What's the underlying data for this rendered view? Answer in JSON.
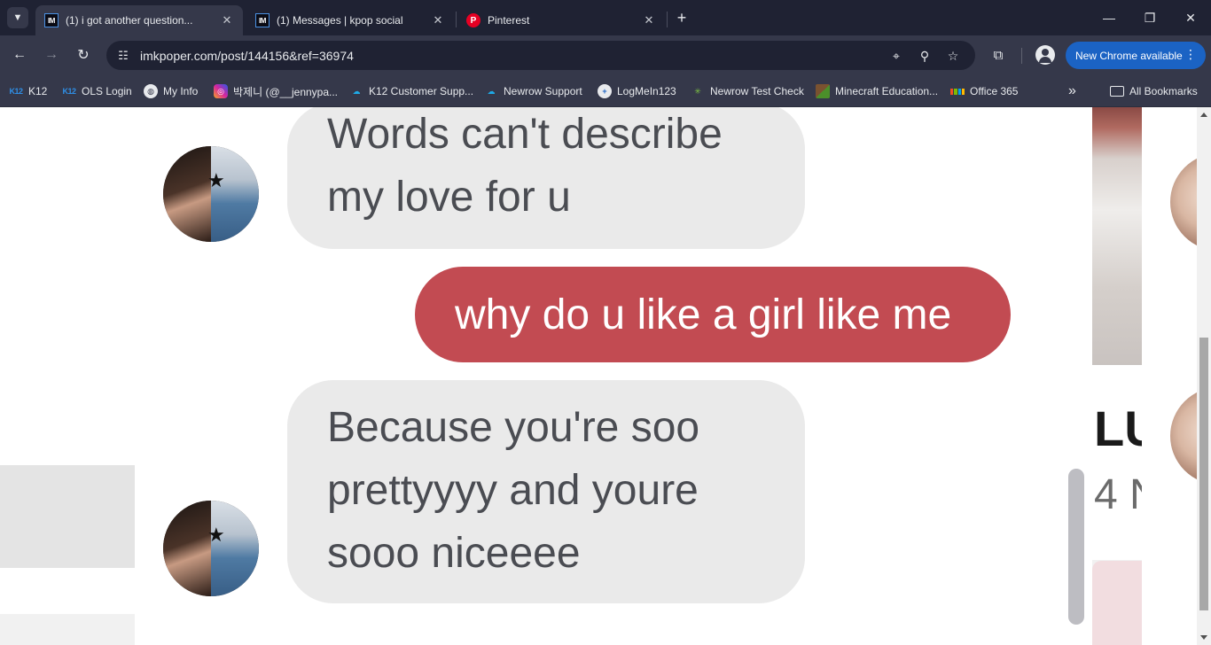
{
  "browser": {
    "tabs": [
      {
        "title": "(1) i got another question...",
        "favicon": "IM",
        "active": true
      },
      {
        "title": "(1) Messages | kpop social",
        "favicon": "IM",
        "active": false
      },
      {
        "title": "Pinterest",
        "favicon": "P",
        "active": false
      }
    ],
    "tab_search_icon": "chevron-down-icon",
    "new_tab_label": "+",
    "window_controls": {
      "minimize": "—",
      "restore": "❐",
      "close": "✕"
    },
    "close_glyph": "✕",
    "url": "imkpoper.com/post/144156&ref=36974",
    "nav": {
      "back": "←",
      "forward": "→",
      "reload": "↻"
    },
    "update_button": "New Chrome available",
    "update_menu_glyph": "⋮"
  },
  "bookmarks": [
    {
      "label": "K12",
      "icon": "K12"
    },
    {
      "label": "OLS Login",
      "icon": "K12"
    },
    {
      "label": "My Info",
      "icon": "globe"
    },
    {
      "label": "박제니 (@__jennypa...",
      "icon": "instagram"
    },
    {
      "label": "K12 Customer Supp...",
      "icon": "cloud"
    },
    {
      "label": "Newrow Support",
      "icon": "cloud"
    },
    {
      "label": "LogMeIn123",
      "icon": "plus"
    },
    {
      "label": "Newrow Test Check",
      "icon": "burst"
    },
    {
      "label": "Minecraft Education...",
      "icon": "minecraft"
    },
    {
      "label": "Office 365",
      "icon": "microsoft"
    }
  ],
  "bookmarks_overflow": "»",
  "all_bookmarks": "All Bookmarks",
  "chat": {
    "messages": [
      {
        "from": "them",
        "lines": [
          "Words can't describe",
          "my love for u"
        ]
      },
      {
        "from": "me",
        "lines": [
          "why do u like a girl like me"
        ]
      },
      {
        "from": "them",
        "lines": [
          "Because you're soo",
          "prettyyyy and youre",
          "sooo niceeee"
        ]
      }
    ],
    "colors": {
      "them_bubble": "#eaeaea",
      "me_bubble": "#c24b52"
    }
  },
  "sidebar_peek": {
    "text_1": "LU",
    "text_2": "4 N"
  }
}
